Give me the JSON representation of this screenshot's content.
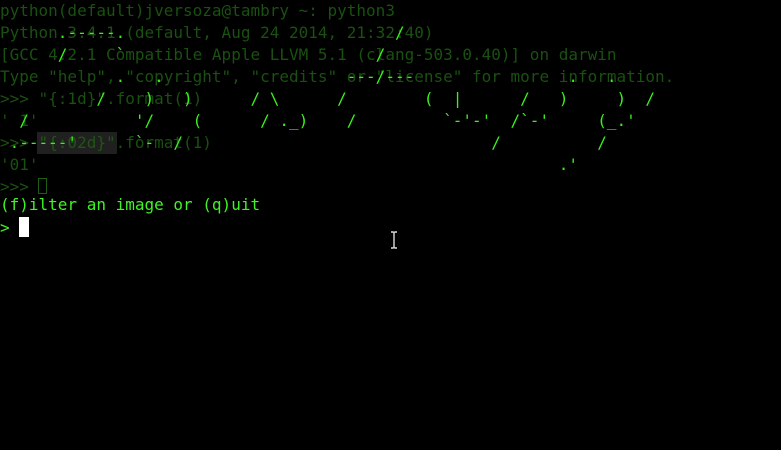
{
  "terminal": {
    "background_color": "#000000",
    "text_color": "#42f227",
    "dim_text_color": "#1f5f14",
    "background_lines": [
      "python(default)jversoza@tambry ~: python3",
      "Python 3.4.1 (default, Aug 24 2014, 21:32:40)",
      "[GCC 4.2.1 Compatible Apple LLVM 5.1 (clang-503.0.40)] on darwin",
      "Type \"help\", \"copyright\", \"credits\" or \"license\" for more information.",
      ">>> \"{:1d}\".format(1)",
      "' 1'",
      ">>> \"{:02d}\".format(1)",
      "'01'",
      ">>> "
    ],
    "ascii_art_lines": [
      "",
      "      .-----.                            /",
      "      /     `                          /",
      "            .   .                   ---/---                .   .",
      "          /    )   )      / \\      /        (  |      /   )     )  /",
      "  /           '/    (      / ._)    /         `-'-'  /`-'     (_.'",
      " .-----'      `-  /                                /          /",
      "                                                          .'",
      ""
    ],
    "menu_text": "(f)ilter an image or (q)uit",
    "prompt_symbol": ">",
    "cursor_icon": "text-cursor-icon"
  }
}
